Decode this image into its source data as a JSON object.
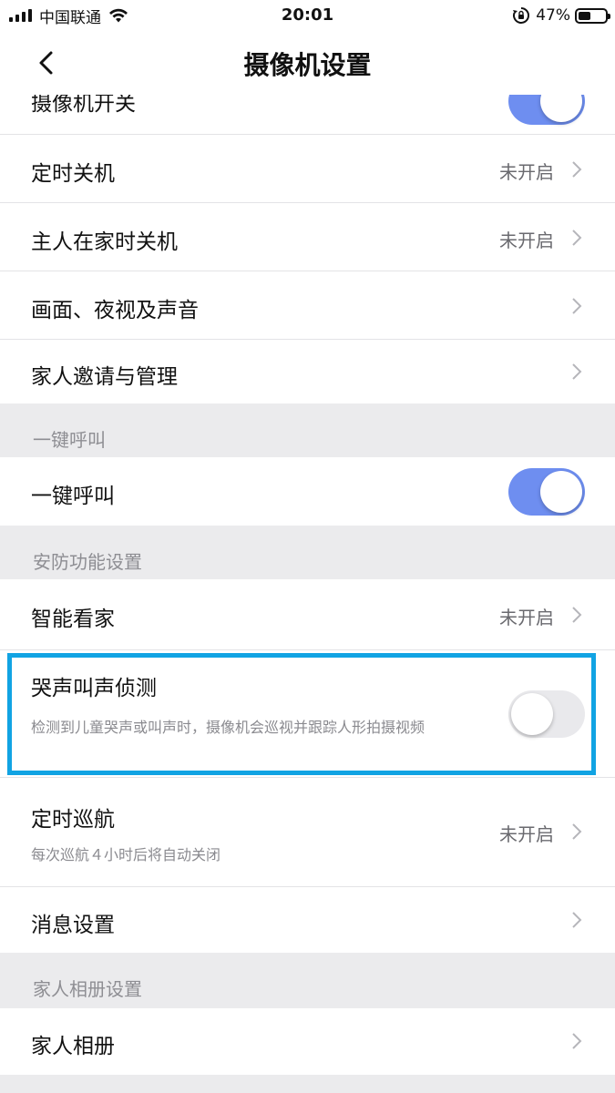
{
  "status_bar": {
    "carrier": "中国联通",
    "time": "20:01",
    "battery_percent": "47%",
    "battery_level": 0.47
  },
  "nav": {
    "title": "摄像机设置"
  },
  "rows": {
    "camera_switch": {
      "label": "摄像机开关",
      "on": true
    },
    "timed_off": {
      "label": "定时关机",
      "value": "未开启"
    },
    "home_off": {
      "label": "主人在家时关机",
      "value": "未开启"
    },
    "picture": {
      "label": "画面、夜视及声音"
    },
    "family_invite": {
      "label": "家人邀请与管理"
    },
    "one_key_call": {
      "label": "一键呼叫",
      "on": true
    },
    "smart_watch": {
      "label": "智能看家",
      "value": "未开启"
    },
    "cry_detect": {
      "label": "哭声叫声侦测",
      "description": "检测到儿童哭声或叫声时，摄像机会巡视并跟踪人形拍摄视频",
      "on": false
    },
    "cruise": {
      "label": "定时巡航",
      "description": "每次巡航４小时后将自动关闭",
      "value": "未开启"
    },
    "message": {
      "label": "消息设置"
    },
    "family_album": {
      "label": "家人相册"
    }
  },
  "sections": {
    "one_key_call": "一键呼叫",
    "security": "安防功能设置",
    "album": "家人相册设置"
  },
  "colors": {
    "toggle_on": "#6e8ef0",
    "highlight": "#11a3e3"
  }
}
